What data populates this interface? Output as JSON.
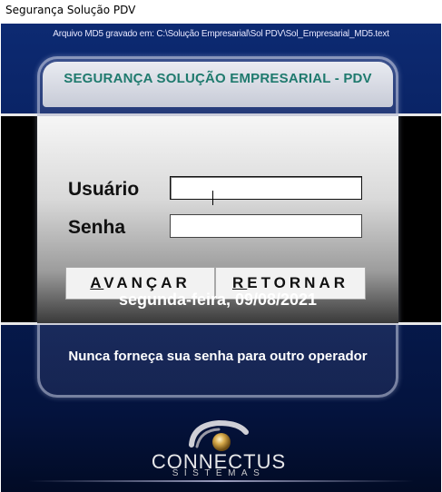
{
  "window": {
    "title": "Segurança Solução PDV"
  },
  "header": {
    "path_info": "Arquivo MD5 gravado em: C:\\Solução Empresarial\\Sol PDV\\Sol_Empresarial_MD5.text"
  },
  "panel": {
    "title": "SEGURANÇA SOLUÇÃO EMPRESARIAL - PDV"
  },
  "form": {
    "user_label": "Usuário",
    "user_value": "",
    "password_label": "Senha",
    "password_value": ""
  },
  "buttons": {
    "advance_mnemonic": "A",
    "advance_rest": "VANÇAR",
    "return_mnemonic": "R",
    "return_rest": "ETORNAR"
  },
  "status": {
    "date": "segunda-feira, 09/08/2021",
    "warning": "Nunca forneça sua senha para outro operador"
  },
  "logo": {
    "name": "CONNECTUS",
    "subtitle": "SISTEMAS"
  },
  "colors": {
    "title_teal": "#1f7a6e",
    "background_navy": "#0a2466"
  }
}
